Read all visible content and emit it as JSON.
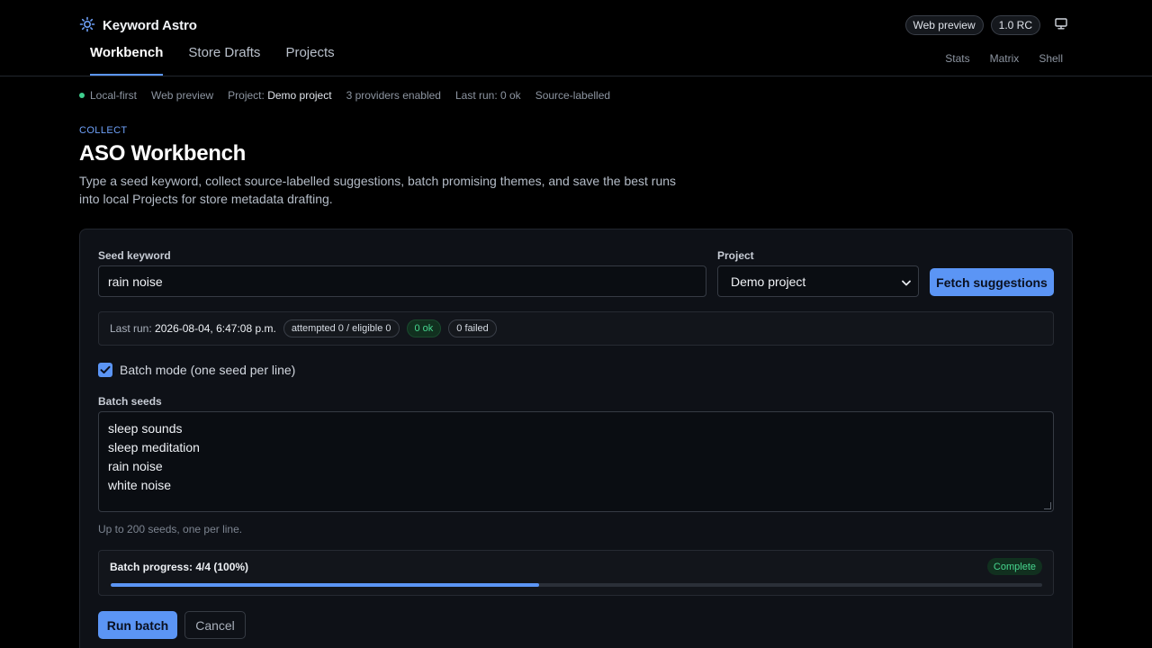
{
  "app": {
    "name": "Keyword Astro",
    "badges": [
      "Web preview",
      "1.0 RC"
    ]
  },
  "nav": {
    "tabs": [
      {
        "label": "Workbench",
        "active": true
      },
      {
        "label": "Store Drafts",
        "active": false
      },
      {
        "label": "Projects",
        "active": false
      }
    ],
    "secondary": [
      "Stats",
      "Matrix",
      "Shell"
    ]
  },
  "status": {
    "local": "Local-first",
    "mode": "Web preview",
    "project_prefix": "Project:",
    "project_name": "Demo project",
    "providers": "3 providers enabled",
    "last_run": "Last run: 0 ok",
    "source": "Source-labelled"
  },
  "heading": {
    "eyebrow": "COLLECT",
    "title": "ASO Workbench",
    "description": "Type a seed keyword, collect source-labelled suggestions, batch promising themes, and save the best runs into local Projects for store metadata drafting."
  },
  "form": {
    "seed_label": "Seed keyword",
    "seed_value": "rain noise",
    "project_label": "Project",
    "project_value": "Demo project",
    "fetch_label": "Fetch suggestions"
  },
  "run": {
    "last_prefix": "Last run:",
    "last_time": "2026-08-04, 6:47:08 p.m.",
    "attempted": "attempted 0 / eligible 0",
    "ok": "0 ok",
    "failed": "0 failed"
  },
  "batch": {
    "toggle_label": "Batch mode (one seed per line)",
    "toggle_checked": true,
    "seeds_label": "Batch seeds",
    "seeds": [
      "sleep sounds",
      "sleep meditation",
      "rain noise",
      "white noise"
    ],
    "hint": "Up to 200 seeds, one per line.",
    "progress_label": "Batch progress: 4/4 (100%)",
    "progress_fraction": 0.46,
    "status": "Complete",
    "run_label": "Run batch",
    "cancel_label": "Cancel"
  },
  "colors": {
    "accent": "#5b95f5",
    "success": "#47d68f",
    "background": "#000000",
    "card": "#0e1117"
  }
}
